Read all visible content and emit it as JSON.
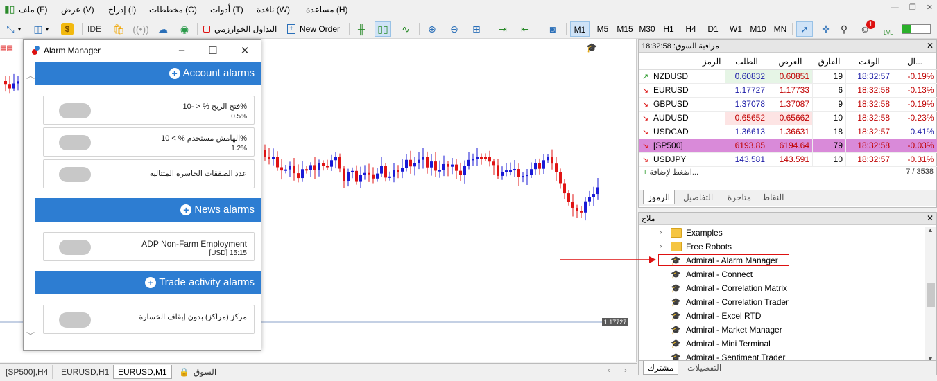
{
  "menu": [
    "مساعدة (H)",
    "نافذة (W)",
    "أدوات (T)",
    "مخططات (C)",
    "إدراج (I)",
    "عرض (V)",
    "ملف (F)"
  ],
  "toolbar": {
    "ide": "IDE",
    "algo_trading": "التداول الخوارزمي",
    "new_order": "New Order",
    "timeframes": [
      "M1",
      "M5",
      "M15",
      "M30",
      "H1",
      "H4",
      "D1",
      "W1",
      "M10",
      "MN"
    ],
    "active_timeframe": "M1",
    "notification_count": "1",
    "lvl": "LVL"
  },
  "alarm_manager": {
    "title": "Alarm Manager",
    "sections": [
      {
        "title": "Account alarms",
        "items": [
          {
            "label": "فتح الربح % < -10%",
            "value": "0.5%"
          },
          {
            "label": "الهامش مستخدم % > 10%",
            "value": "1.2%"
          },
          {
            "label": "عدد الصفقات الخاسرة المتتالية",
            "value": ""
          }
        ]
      },
      {
        "title": "News alarms",
        "items": [
          {
            "label": "ADP Non-Farm Employment",
            "value": "[USD] 15:15"
          }
        ]
      },
      {
        "title": "Trade activity alarms",
        "items": [
          {
            "label": "مركز (مراكز) بدون إيقاف الخسارة",
            "value": ""
          }
        ]
      }
    ]
  },
  "chart": {
    "current_price": "1.17727",
    "accent_up": "#1a1ad6",
    "accent_down": "#e01414"
  },
  "chart_tabs": [
    "[SP500],H4",
    "EURUSD,H1",
    "EURUSD,M1",
    "السوق"
  ],
  "active_chart_tab": "EURUSD,M1",
  "market_watch": {
    "title": "مراقبة السوق: 18:32:58",
    "columns": [
      "الرمز",
      "الطلب",
      "العرض",
      "الفارق",
      "الوقت",
      "ال..."
    ],
    "rows": [
      {
        "symbol": "NZDUSD",
        "bid": "0.60832",
        "ask": "0.60851",
        "spread": "19",
        "time": "18:32:57",
        "change": "-0.19%",
        "dir": "up"
      },
      {
        "symbol": "EURUSD",
        "bid": "1.17727",
        "ask": "1.17733",
        "spread": "6",
        "time": "18:32:58",
        "change": "-0.13%",
        "dir": "down"
      },
      {
        "symbol": "GBPUSD",
        "bid": "1.37078",
        "ask": "1.37087",
        "spread": "9",
        "time": "18:32:58",
        "change": "-0.19%",
        "dir": "down"
      },
      {
        "symbol": "AUDUSD",
        "bid": "0.65652",
        "ask": "0.65662",
        "spread": "10",
        "time": "18:32:58",
        "change": "-0.23%",
        "dir": "down"
      },
      {
        "symbol": "USDCAD",
        "bid": "1.36613",
        "ask": "1.36631",
        "spread": "18",
        "time": "18:32:57",
        "change": "0.41%",
        "dir": "down"
      },
      {
        "symbol": "[SP500]",
        "bid": "6193.85",
        "ask": "6194.64",
        "spread": "79",
        "time": "18:32:58",
        "change": "-0.03%",
        "dir": "down"
      },
      {
        "symbol": "USDJPY",
        "bid": "143.581",
        "ask": "143.591",
        "spread": "10",
        "time": "18:32:57",
        "change": "-0.31%",
        "dir": "down"
      }
    ],
    "add_label": "اضغط لإضافة...",
    "count": "7 / 3538",
    "tabs": [
      "الرموز",
      "التفاصيل",
      "متاجرة",
      "النقاط"
    ]
  },
  "navigator": {
    "title": "ملاح",
    "items": [
      {
        "label": "Examples",
        "type": "folder"
      },
      {
        "label": "Free Robots",
        "type": "folder"
      },
      {
        "label": "Admiral - Alarm Manager",
        "type": "expert"
      },
      {
        "label": "Admiral - Connect",
        "type": "expert"
      },
      {
        "label": "Admiral - Correlation Matrix",
        "type": "expert"
      },
      {
        "label": "Admiral - Correlation Trader",
        "type": "expert"
      },
      {
        "label": "Admiral - Excel RTD",
        "type": "expert"
      },
      {
        "label": "Admiral - Market Manager",
        "type": "expert"
      },
      {
        "label": "Admiral - Mini Terminal",
        "type": "expert"
      },
      {
        "label": "Admiral - Sentiment Trader",
        "type": "expert"
      }
    ],
    "tabs": [
      "مشترك",
      "التفضيلات"
    ]
  }
}
